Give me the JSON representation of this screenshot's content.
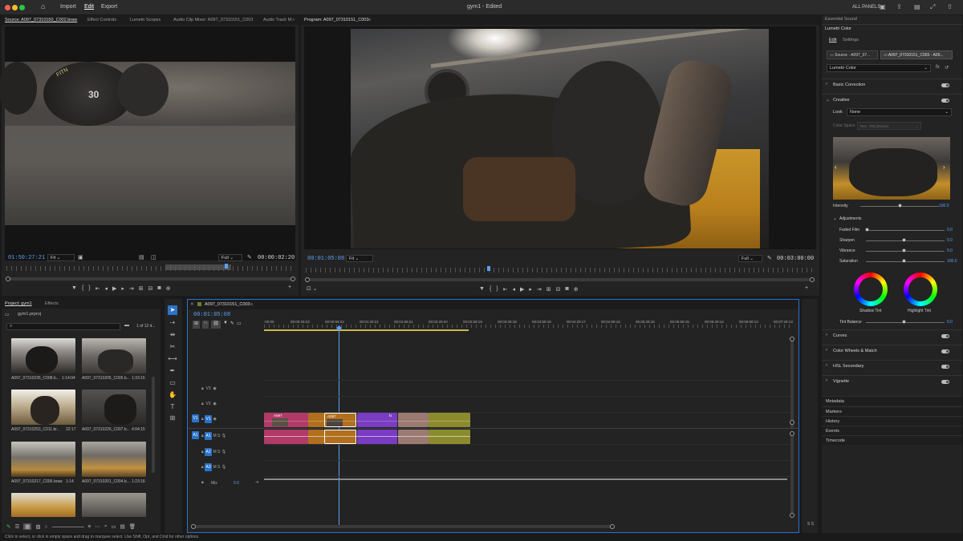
{
  "app": {
    "title": "gym1 - Edited",
    "nav": [
      "Import",
      "Edit",
      "Export"
    ],
    "panels_label": "ALL PANELS"
  },
  "source_panel": {
    "tabs": [
      "Source: A097_07310150_C002.braw",
      "Effect Controls",
      "Lumetri Scopes",
      "Audio Clip Mixer: A097_07310151_C003",
      "Audio Track M"
    ],
    "timecode_in": "01:50:27:21",
    "fit": "Fit",
    "quality": "Full",
    "duration": "00:00:02:20"
  },
  "program_panel": {
    "tab": "Program: A097_07310151_C003",
    "timecode": "00:01:05:08",
    "fit": "Fit",
    "quality": "Full",
    "duration": "00:03:00:00"
  },
  "project_panel": {
    "tabs": [
      "Project: gym1",
      "Effects"
    ],
    "project_file": "gym1.prproj",
    "item_count": "1 of 12 it...",
    "items": [
      {
        "name": "A097_07310235_C008.b...",
        "dur": "1:14:04"
      },
      {
        "name": "A097_07310205_C005.b...",
        "dur": "1:33:15"
      },
      {
        "name": "A097_07310253_C011.br...",
        "dur": "22:17"
      },
      {
        "name": "A097_07310226_C007.b...",
        "dur": "4:04:15"
      },
      {
        "name": "A097_07310217_C006.braw",
        "dur": "1:14"
      },
      {
        "name": "A097_07310201_C004.b...",
        "dur": "1:23:16"
      }
    ]
  },
  "timeline": {
    "tab": "A097_07310151_C003",
    "timecode": "00:01:05:08",
    "ruler": [
      ":00:00",
      "00:00:29:23",
      "00:00:59:22",
      "00:01:29:21",
      "00:01:59:21",
      "00:02:29:20",
      "00:02:59:19",
      "00:03:29:18",
      "00:03:59:18",
      "00:04:29:17",
      "00:04:59:16",
      "00:05:29:16",
      "00:05:59:15",
      "00:06:29:14",
      "00:06:59:13",
      "00:07:29:13"
    ],
    "tracks_video": [
      "V3",
      "V2",
      "V1"
    ],
    "tracks_audio": [
      "A1",
      "A2",
      "A3"
    ],
    "mix_label": "Mix",
    "mix_value": "0.0",
    "clip_labels": [
      "A097",
      "A097"
    ],
    "fx_label": "fx"
  },
  "lumetri": {
    "tabs_top": [
      "Essential Sound",
      "Lumetri Color"
    ],
    "subtabs": [
      "Edit",
      "Settings"
    ],
    "source_label": "Source - A097_07...",
    "clip_label": "A097_07310151_C003 - A09...",
    "effect_dropdown": "Lumetri Color",
    "sections": {
      "basic": "Basic Correction",
      "creative": "Creative",
      "look_label": "Look",
      "look_value": "None",
      "colorspace_label": "Color Space",
      "colorspace_value": "Rec. 709 (Scene)",
      "intensity_label": "Intensity",
      "intensity_value": "100.0",
      "adjustments": "Adjustments",
      "sliders": [
        {
          "label": "Faded Film",
          "value": "0.0",
          "level": 0
        },
        {
          "label": "Sharpen",
          "value": "0.0",
          "level": 0.5
        },
        {
          "label": "Vibrance",
          "value": "0.0",
          "level": 0.5
        },
        {
          "label": "Saturation",
          "value": "100.0",
          "level": 0.5
        }
      ],
      "shadow_tint": "Shadow Tint",
      "highlight_tint": "Highlight Tint",
      "tint_balance_label": "Tint Balance",
      "tint_balance_value": "0.0",
      "curves": "Curves",
      "wheels": "Color Wheels & Match",
      "hsl": "HSL Secondary",
      "vignette": "Vignette"
    },
    "bottom_panels": [
      "Metadata",
      "Markers",
      "History",
      "Events",
      "Timecode"
    ]
  },
  "status_bar": "Click to select, or click in empty space and drag to marquee select. Use Shift, Opt, and Cmd for other options.",
  "colors": {
    "accent": "#5ba0f2",
    "track_blue": "#2b72c9"
  }
}
